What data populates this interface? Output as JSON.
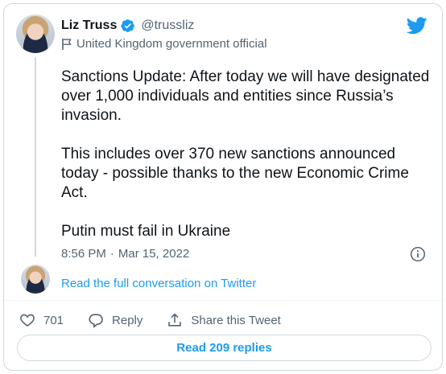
{
  "author": {
    "display_name": "Liz Truss",
    "handle": "@trussliz",
    "label": "United Kingdom government official"
  },
  "tweet": {
    "paragraphs": [
      "Sanctions Update: After today we will have designated over 1,000 individuals and entities since Russia’s invasion.",
      "This includes over 370 new sanctions announced today - possible thanks to the new Economic Crime Act.",
      "Putin must fail in Ukraine"
    ],
    "time": "8:56 PM",
    "separator": "·",
    "date": "Mar 15, 2022"
  },
  "conversation_link": "Read the full conversation on Twitter",
  "actions": {
    "likes": "701",
    "reply_label": "Reply",
    "share_label": "Share this Tweet"
  },
  "read_replies": "Read 209 replies",
  "colors": {
    "accent": "#1d9bf0",
    "text": "#0f1419",
    "muted": "#536471",
    "border": "#cfd9de"
  },
  "icons": [
    "verified-badge-icon",
    "government-flag-icon",
    "twitter-bird-icon",
    "info-icon",
    "heart-icon",
    "reply-icon",
    "share-icon"
  ]
}
